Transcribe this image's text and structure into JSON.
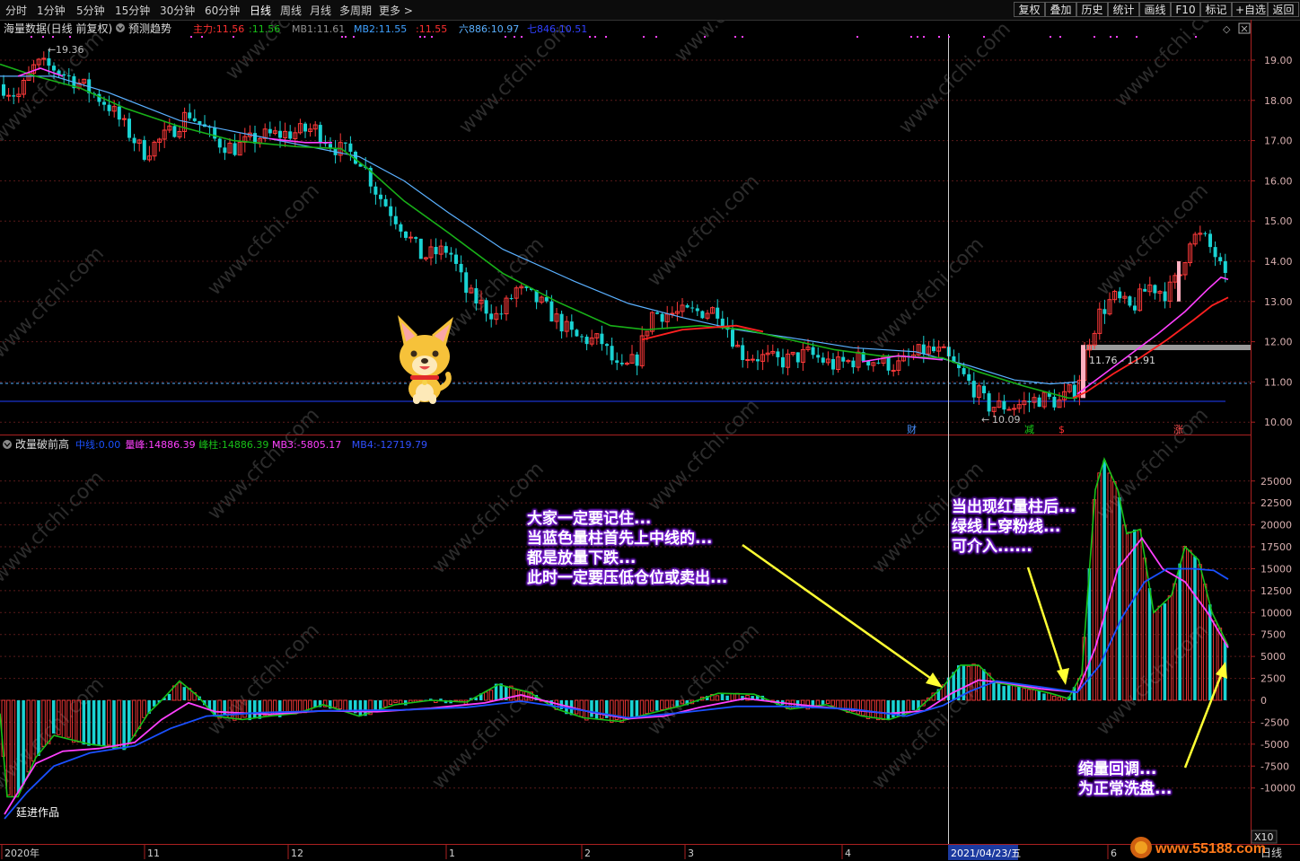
{
  "toolbar": {
    "timeframes": [
      "分时",
      "1分钟",
      "5分钟",
      "15分钟",
      "30分钟",
      "60分钟",
      "日线",
      "周线",
      "月线",
      "多周期",
      "更多 >"
    ],
    "active_timeframe": "日线",
    "tools": [
      "复权",
      "叠加",
      "历史",
      "统计",
      "画线",
      "F10",
      "标记",
      "+自选",
      "返回"
    ]
  },
  "main_panel": {
    "title": "海量数据(日线 前复权)",
    "forecast_label": "预测趋势",
    "indicators": [
      {
        "label": "主力:",
        "value": "11.56",
        "color": "#ff3030"
      },
      {
        "label": ":",
        "value": "11.56",
        "color": "#18c018"
      },
      {
        "label": "MB1:",
        "value": "11.61",
        "color": "#909090"
      },
      {
        "label": "MB2:",
        "value": "11.55",
        "color": "#3fa0ff"
      },
      {
        "label": ":",
        "value": "11.55",
        "color": "#ff3030"
      },
      {
        "label": "六886:",
        "value": "10.97",
        "color": "#5ab0ff"
      },
      {
        "label": "七846:",
        "value": "10.51",
        "color": "#3040ff"
      }
    ],
    "price_axis": [
      "19.00",
      "18.00",
      "17.00",
      "16.00",
      "15.00",
      "14.00",
      "13.00",
      "12.00",
      "11.00",
      "10.00"
    ],
    "high_label": "19.36",
    "low_label": "10.09",
    "range_label": "11.76 - 11.91",
    "markers": [
      "财",
      "减",
      "$",
      "涨"
    ]
  },
  "sub_panel": {
    "title": "改量破前高",
    "indicators": [
      {
        "label": "中线:",
        "value": "0.00",
        "color": "#1a50ff"
      },
      {
        "label": "量峰:",
        "value": "14886.39",
        "color": "#ff40ff"
      },
      {
        "label": "峰柱:",
        "value": "14886.39",
        "color": "#18c018"
      },
      {
        "label": "MB3:",
        "value": "-5805.17",
        "color": "#ff40ff"
      },
      {
        "label": "MB4:",
        "value": "-12719.79",
        "color": "#3050ff"
      }
    ],
    "volume_axis": [
      "25000",
      "22500",
      "20000",
      "17500",
      "15000",
      "12500",
      "10000",
      "7500",
      "5000",
      "2500",
      "0",
      "-2500",
      "-5000",
      "-7500",
      "-10000"
    ],
    "scale_label": "X10",
    "author": "廷进作品"
  },
  "annotations": {
    "left": [
      "大家一定要记住...",
      "当蓝色量柱首先上中线的...",
      "都是放量下跌...",
      "此时一定要压低仓位或卖出..."
    ],
    "middle": [
      "当出现红量柱后...",
      "绿线上穿粉线...",
      "可介入......"
    ],
    "right": [
      "缩量回调...",
      "为正常洗盘..."
    ]
  },
  "time_axis": {
    "labels": [
      "2020年",
      "11",
      "12",
      "1",
      "2",
      "3",
      "4",
      "6"
    ],
    "cursor_date": "2021/04/23/五",
    "period": "日线"
  },
  "watermark": "www.cfchi.com",
  "logo_text": "www.55188.com",
  "colors": {
    "up": "#ff3a3a",
    "down": "#1ad3d3",
    "green_line": "#18c018",
    "pink_line": "#ff40ff",
    "blue_line": "#1a50ff",
    "light_blue": "#5ab0ff",
    "annotation_glow": "#7a1fd6"
  }
}
